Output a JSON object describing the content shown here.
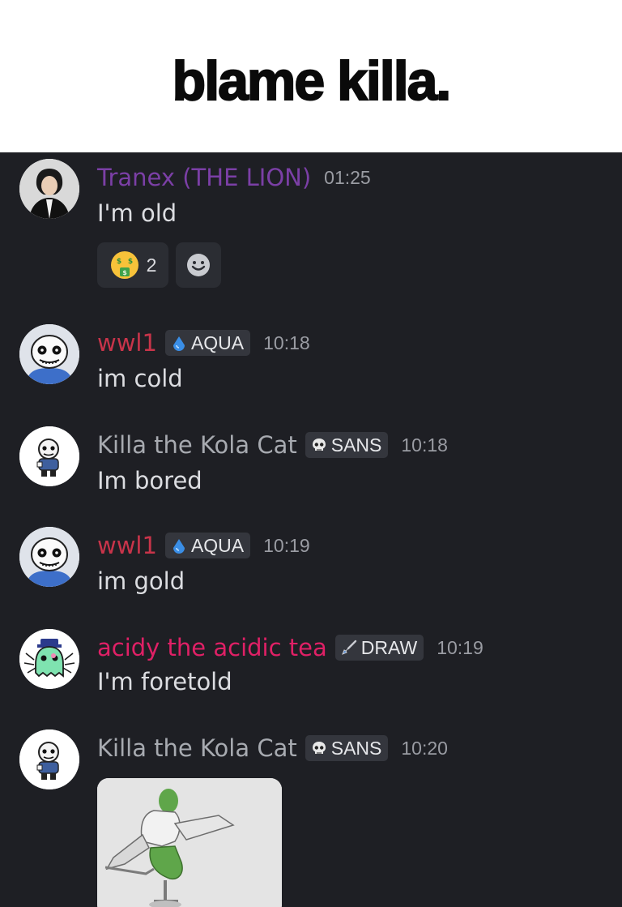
{
  "caption": {
    "text": "blame killa."
  },
  "colors": {
    "chat_bg": "#1e1f24",
    "purple_role": "#7b3fa6",
    "red_role": "#c8344a",
    "pink_role": "#e02066",
    "gray_role": "#a7aab0"
  },
  "messages": [
    {
      "author": "Tranex (THE LION)",
      "time": "01:25",
      "text": "I'm old",
      "avatar": "photo-avatar",
      "reactions": [
        {
          "icon": "money-mouth-face-icon",
          "count": "2"
        },
        {
          "icon": "add-reaction-icon"
        }
      ]
    },
    {
      "author": "wwl1",
      "tag": "AQUA",
      "tag_icon": "water-drop-icon",
      "time": "10:18",
      "text": "im cold",
      "avatar": "sans-skull-avatar"
    },
    {
      "author": "Killa the Kola Cat",
      "tag": "SANS",
      "tag_icon": "skull-icon",
      "time": "10:18",
      "text": "Im bored",
      "avatar": "sans-sprite-avatar"
    },
    {
      "author": "wwl1",
      "tag": "AQUA",
      "tag_icon": "water-drop-icon",
      "time": "10:19",
      "text": "im gold",
      "avatar": "sans-skull-avatar"
    },
    {
      "author": "acidy the acidic tea",
      "tag": "DRAW",
      "tag_icon": "brush-icon",
      "time": "10:19",
      "text": "I'm foretold",
      "avatar": "ghost-drawing-avatar"
    },
    {
      "author": "Killa the Kola Cat",
      "tag": "SANS",
      "tag_icon": "skull-icon",
      "time": "10:20",
      "avatar": "sans-sprite-avatar",
      "attachment": "gif-image"
    }
  ]
}
